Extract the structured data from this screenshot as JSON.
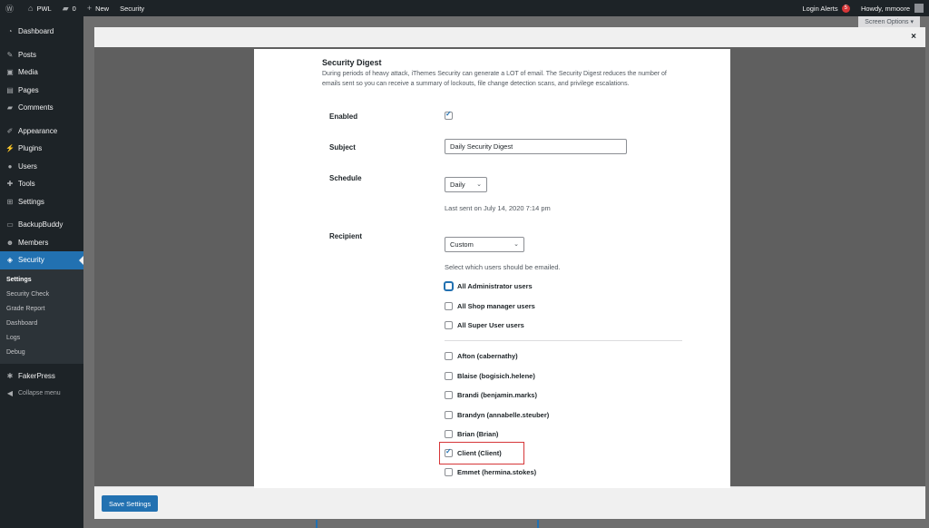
{
  "adminbar": {
    "site_name": "PWL",
    "comments_count": "0",
    "new_label": "New",
    "security_label": "Security",
    "login_alerts_label": "Login Alerts",
    "login_alerts_count": "5",
    "howdy": "Howdy, mmoore"
  },
  "sidebar": {
    "items": [
      {
        "label": "Dashboard",
        "icon": "dashboard-icon"
      },
      {
        "label": "Posts",
        "icon": "pin-icon"
      },
      {
        "label": "Media",
        "icon": "media-icon"
      },
      {
        "label": "Pages",
        "icon": "page-icon"
      },
      {
        "label": "Comments",
        "icon": "comment-icon"
      },
      {
        "label": "Appearance",
        "icon": "brush-icon"
      },
      {
        "label": "Plugins",
        "icon": "plug-icon"
      },
      {
        "label": "Users",
        "icon": "user-icon"
      },
      {
        "label": "Tools",
        "icon": "wrench-icon"
      },
      {
        "label": "Settings",
        "icon": "settings-icon"
      },
      {
        "label": "BackupBuddy",
        "icon": "backup-icon"
      },
      {
        "label": "Members",
        "icon": "members-icon"
      },
      {
        "label": "Security",
        "icon": "shield-icon"
      }
    ],
    "submenu": [
      "Settings",
      "Security Check",
      "Grade Report",
      "Dashboard",
      "Logs",
      "Debug"
    ],
    "fakerpress": "FakerPress",
    "collapse": "Collapse menu"
  },
  "screen_options": "Screen Options ▾",
  "modal": {
    "close": "×",
    "save_button": "Save Settings"
  },
  "digest": {
    "title": "Security Digest",
    "description": "During periods of heavy attack, iThemes Security can generate a LOT of email. The Security Digest reduces the number of emails sent so you can receive a summary of lockouts, file change detection scans, and privilege escalations.",
    "enabled_label": "Enabled",
    "enabled": true,
    "subject_label": "Subject",
    "subject_value": "Daily Security Digest",
    "schedule_label": "Schedule",
    "schedule_value": "Daily",
    "last_sent": "Last sent on July 14, 2020 7:14 pm",
    "recipient_label": "Recipient",
    "recipient_value": "Custom",
    "recipient_help": "Select which users should be emailed.",
    "groups": [
      {
        "label": "All Administrator users",
        "checked": false
      },
      {
        "label": "All Shop manager users",
        "checked": false
      },
      {
        "label": "All Super User users",
        "checked": false
      }
    ],
    "users": [
      {
        "label": "Afton (cabernathy)",
        "checked": false
      },
      {
        "label": "Blaise (bogisich.helene)",
        "checked": false
      },
      {
        "label": "Brandi (benjamin.marks)",
        "checked": false
      },
      {
        "label": "Brandyn (annabelle.steuber)",
        "checked": false
      },
      {
        "label": "Brian (Brian)",
        "checked": false
      },
      {
        "label": "Client (Client)",
        "checked": true
      },
      {
        "label": "Emmet (hermina.stokes)",
        "checked": false
      }
    ]
  },
  "colors": {
    "admin_dark": "#1d2327",
    "accent_blue": "#2271b1",
    "highlight_red": "#d63638"
  }
}
